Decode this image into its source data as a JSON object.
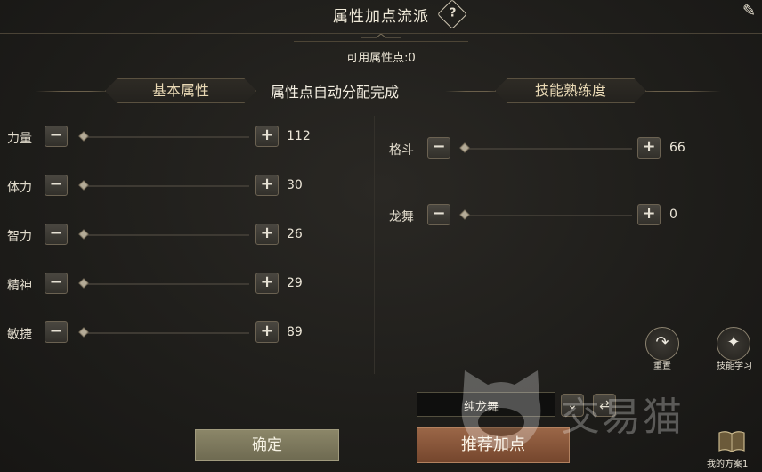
{
  "window": {
    "title": "属性加点流派",
    "help_glyph": "?",
    "close_glyph": "✎"
  },
  "available": {
    "text": "可用属性点:0"
  },
  "tabs": {
    "basic": "基本属性",
    "skill": "技能熟练度"
  },
  "message": "属性点自动分配完成",
  "attributes": [
    {
      "label": "力量",
      "value": "112"
    },
    {
      "label": "体力",
      "value": "30"
    },
    {
      "label": "智力",
      "value": "26"
    },
    {
      "label": "精神",
      "value": "29"
    },
    {
      "label": "敏捷",
      "value": "89"
    }
  ],
  "skills": [
    {
      "label": "格斗",
      "value": "66"
    },
    {
      "label": "龙舞",
      "value": "0"
    }
  ],
  "controls": {
    "minus_glyph": "−",
    "plus_glyph": "+"
  },
  "actions": {
    "reset_label": "重置",
    "skill_learn_label": "技能学习",
    "confirm_label": "确定",
    "recommend_label": "推荐加点",
    "my_scheme_label": "我的方案1"
  },
  "scheme": {
    "name": "纯龙舞"
  },
  "watermark": {
    "text": "交易猫"
  },
  "colors": {
    "confirm": "#7d7a5e",
    "recommend": "#8a573a",
    "accent_text": "#e9d9b5"
  }
}
